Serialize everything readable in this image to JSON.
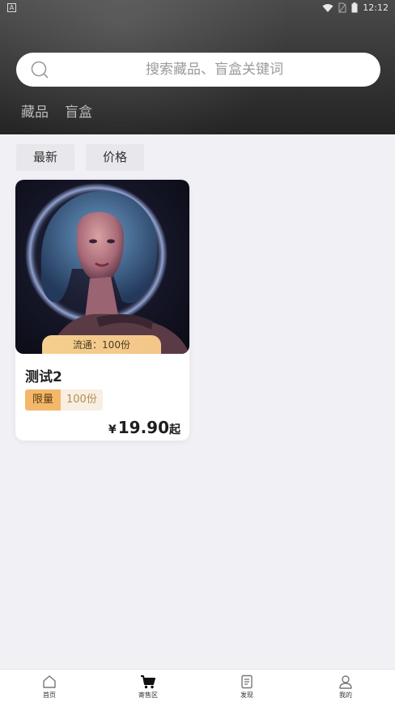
{
  "status_bar": {
    "app_indicator": "A",
    "time": "12:12"
  },
  "search": {
    "placeholder": "搜索藏品、盲盒关键词"
  },
  "category_tabs": [
    {
      "label": "藏品"
    },
    {
      "label": "盲盒"
    }
  ],
  "sort": [
    {
      "label": "最新"
    },
    {
      "label": "价格"
    }
  ],
  "products": [
    {
      "circulation": "流通：100份",
      "title": "测试2",
      "tag_limited": "限量",
      "tag_count": "100份",
      "price_symbol": "¥",
      "price": "19.90",
      "price_suffix": "起"
    }
  ],
  "bottom_nav": [
    {
      "label": "首页",
      "icon": "home-icon"
    },
    {
      "label": "寄售区",
      "icon": "cart-icon",
      "active": true
    },
    {
      "label": "发现",
      "icon": "discover-icon"
    },
    {
      "label": "我的",
      "icon": "profile-icon"
    }
  ],
  "colors": {
    "header_bg": "#333333",
    "badge_gold": "#f5cf8d",
    "tag_orange": "#f4b86a"
  }
}
